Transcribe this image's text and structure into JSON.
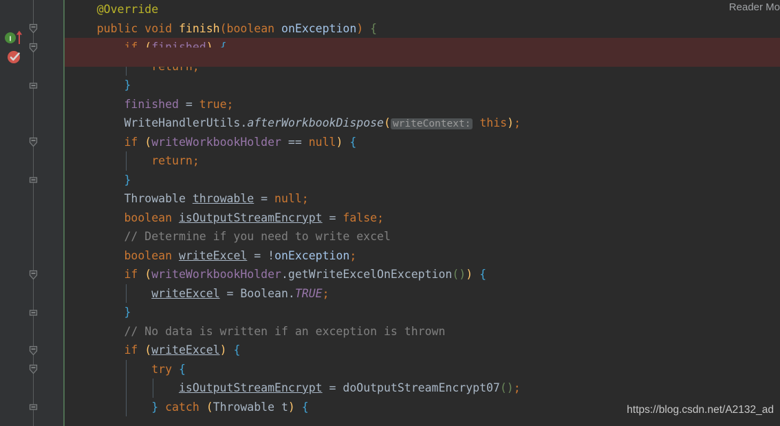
{
  "app": {
    "reader_mode_label": "Reader Mo",
    "watermark": "https://blog.csdn.net/A2132_ad"
  },
  "gutter": {
    "markers": [
      {
        "name": "implementing-method-marker",
        "icon": "implemented-interface-icon",
        "line": 2,
        "tooltip": "Implements method"
      },
      {
        "name": "breakpoint-marker",
        "icon": "breakpoint-verified-icon",
        "line": 3,
        "tooltip": "Line breakpoint verified"
      }
    ],
    "fold_icons": [
      {
        "line": 2,
        "state": "expanded"
      },
      {
        "line": 3,
        "state": "expanded"
      },
      {
        "line": 5,
        "state": "collapsed"
      },
      {
        "line": 8,
        "state": "expanded"
      },
      {
        "line": 10,
        "state": "collapsed"
      },
      {
        "line": 15,
        "state": "expanded"
      },
      {
        "line": 17,
        "state": "collapsed"
      },
      {
        "line": 19,
        "state": "expanded"
      },
      {
        "line": 20,
        "state": "expanded"
      },
      {
        "line": 22,
        "state": "collapsed"
      }
    ],
    "vcs_stripe_color": "#4f6f52"
  },
  "theme": {
    "background": "#2b2b2b",
    "gutter_background": "#313335",
    "default_text": "#a9b7c6",
    "keyword": "#cc7832",
    "annotation": "#bbb529",
    "method_declaration": "#ffc66d",
    "field": "#9876aa",
    "parameter": "#a3c4e8",
    "comment": "#808080",
    "brace": "#42a3d4",
    "breakpoint_line_background": "#4b2b2b",
    "hint_chip_background": "#4e5254",
    "hint_chip_text": "#9b9b9b"
  },
  "code": {
    "language": "Java",
    "lines": [
      {
        "n": 1,
        "indent": 1,
        "highlight": false,
        "guides": [],
        "tokens": [
          {
            "t": "@Override",
            "c": "anno"
          }
        ]
      },
      {
        "n": 2,
        "indent": 1,
        "highlight": false,
        "guides": [],
        "tokens": [
          {
            "t": "public",
            "c": "kw"
          },
          {
            "t": " ",
            "c": "op"
          },
          {
            "t": "void",
            "c": "kw"
          },
          {
            "t": " ",
            "c": "op"
          },
          {
            "t": "finish",
            "c": "mdecl"
          },
          {
            "t": "(",
            "c": "br1"
          },
          {
            "t": "boolean",
            "c": "kw"
          },
          {
            "t": " ",
            "c": "op"
          },
          {
            "t": "onException",
            "c": "param"
          },
          {
            "t": ")",
            "c": "br1"
          },
          {
            "t": " ",
            "c": "op"
          },
          {
            "t": "{",
            "c": "br3"
          }
        ]
      },
      {
        "n": 3,
        "indent": 2,
        "highlight": true,
        "guides": [],
        "tokens": [
          {
            "t": "if",
            "c": "kw"
          },
          {
            "t": " ",
            "c": "op"
          },
          {
            "t": "(",
            "c": "br2"
          },
          {
            "t": "finished",
            "c": "field"
          },
          {
            "t": ")",
            "c": "br2"
          },
          {
            "t": " ",
            "c": "op"
          },
          {
            "t": "{",
            "c": "brace"
          }
        ]
      },
      {
        "n": 4,
        "indent": 3,
        "highlight": false,
        "guides": [
          2
        ],
        "tokens": [
          {
            "t": "return",
            "c": "kw"
          },
          {
            "t": ";",
            "c": "sm"
          }
        ]
      },
      {
        "n": 5,
        "indent": 2,
        "highlight": false,
        "guides": [],
        "tokens": [
          {
            "t": "}",
            "c": "brace"
          }
        ]
      },
      {
        "n": 6,
        "indent": 2,
        "highlight": false,
        "guides": [],
        "tokens": [
          {
            "t": "finished",
            "c": "field"
          },
          {
            "t": " = ",
            "c": "op"
          },
          {
            "t": "true",
            "c": "kw"
          },
          {
            "t": ";",
            "c": "sm"
          }
        ]
      },
      {
        "n": 7,
        "indent": 2,
        "highlight": false,
        "guides": [],
        "tokens": [
          {
            "t": "WriteHandlerUtils",
            "c": "cls"
          },
          {
            "t": ".",
            "c": "op"
          },
          {
            "t": "afterWorkbookDispose",
            "c": "ital"
          },
          {
            "t": "(",
            "c": "br2"
          },
          {
            "t": "HINT:writeContext:",
            "c": "hint"
          },
          {
            "t": " ",
            "c": "op"
          },
          {
            "t": "this",
            "c": "kw"
          },
          {
            "t": ")",
            "c": "br2"
          },
          {
            "t": ";",
            "c": "sm"
          }
        ]
      },
      {
        "n": 8,
        "indent": 2,
        "highlight": false,
        "guides": [],
        "tokens": [
          {
            "t": "if",
            "c": "kw"
          },
          {
            "t": " ",
            "c": "op"
          },
          {
            "t": "(",
            "c": "br2"
          },
          {
            "t": "writeWorkbookHolder",
            "c": "field"
          },
          {
            "t": " == ",
            "c": "op"
          },
          {
            "t": "null",
            "c": "kw"
          },
          {
            "t": ")",
            "c": "br2"
          },
          {
            "t": " ",
            "c": "op"
          },
          {
            "t": "{",
            "c": "brace"
          }
        ]
      },
      {
        "n": 9,
        "indent": 3,
        "highlight": false,
        "guides": [
          2
        ],
        "tokens": [
          {
            "t": "return",
            "c": "kw"
          },
          {
            "t": ";",
            "c": "sm"
          }
        ]
      },
      {
        "n": 10,
        "indent": 2,
        "highlight": false,
        "guides": [],
        "tokens": [
          {
            "t": "}",
            "c": "brace"
          }
        ]
      },
      {
        "n": 11,
        "indent": 2,
        "highlight": false,
        "guides": [],
        "tokens": [
          {
            "t": "Throwable",
            "c": "cls"
          },
          {
            "t": " ",
            "c": "op"
          },
          {
            "t": "throwable",
            "c": "lvar"
          },
          {
            "t": " = ",
            "c": "op"
          },
          {
            "t": "null",
            "c": "kw"
          },
          {
            "t": ";",
            "c": "sm"
          }
        ]
      },
      {
        "n": 12,
        "indent": 2,
        "highlight": false,
        "guides": [],
        "tokens": [
          {
            "t": "boolean",
            "c": "kw"
          },
          {
            "t": " ",
            "c": "op"
          },
          {
            "t": "isOutputStreamEncrypt",
            "c": "lvar"
          },
          {
            "t": " = ",
            "c": "op"
          },
          {
            "t": "false",
            "c": "kw"
          },
          {
            "t": ";",
            "c": "sm"
          }
        ]
      },
      {
        "n": 13,
        "indent": 2,
        "highlight": false,
        "guides": [],
        "tokens": [
          {
            "t": "// Determine if you need to write excel",
            "c": "cmt"
          }
        ]
      },
      {
        "n": 14,
        "indent": 2,
        "highlight": false,
        "guides": [],
        "tokens": [
          {
            "t": "boolean",
            "c": "kw"
          },
          {
            "t": " ",
            "c": "op"
          },
          {
            "t": "writeExcel",
            "c": "lvar"
          },
          {
            "t": " = !",
            "c": "op"
          },
          {
            "t": "onException",
            "c": "param"
          },
          {
            "t": ";",
            "c": "sm"
          }
        ]
      },
      {
        "n": 15,
        "indent": 2,
        "highlight": false,
        "guides": [],
        "tokens": [
          {
            "t": "if",
            "c": "kw"
          },
          {
            "t": " ",
            "c": "op"
          },
          {
            "t": "(",
            "c": "br2"
          },
          {
            "t": "writeWorkbookHolder",
            "c": "field"
          },
          {
            "t": ".",
            "c": "op"
          },
          {
            "t": "getWriteExcelOnException",
            "c": "mcall"
          },
          {
            "t": "()",
            "c": "br3"
          },
          {
            "t": ")",
            "c": "br2"
          },
          {
            "t": " ",
            "c": "op"
          },
          {
            "t": "{",
            "c": "brace"
          }
        ]
      },
      {
        "n": 16,
        "indent": 3,
        "highlight": false,
        "guides": [
          2
        ],
        "tokens": [
          {
            "t": "writeExcel",
            "c": "lvar"
          },
          {
            "t": " = ",
            "c": "op"
          },
          {
            "t": "Boolean",
            "c": "cls"
          },
          {
            "t": ".",
            "c": "op"
          },
          {
            "t": "TRUE",
            "c": "sfield"
          },
          {
            "t": ";",
            "c": "sm"
          }
        ]
      },
      {
        "n": 17,
        "indent": 2,
        "highlight": false,
        "guides": [],
        "tokens": [
          {
            "t": "}",
            "c": "brace"
          }
        ]
      },
      {
        "n": 18,
        "indent": 2,
        "highlight": false,
        "guides": [],
        "tokens": [
          {
            "t": "// No data is written if an exception is thrown",
            "c": "cmt"
          }
        ]
      },
      {
        "n": 19,
        "indent": 2,
        "highlight": false,
        "guides": [],
        "tokens": [
          {
            "t": "if",
            "c": "kw"
          },
          {
            "t": " ",
            "c": "op"
          },
          {
            "t": "(",
            "c": "br2"
          },
          {
            "t": "writeExcel",
            "c": "lvar"
          },
          {
            "t": ")",
            "c": "br2"
          },
          {
            "t": " ",
            "c": "op"
          },
          {
            "t": "{",
            "c": "brace"
          }
        ]
      },
      {
        "n": 20,
        "indent": 3,
        "highlight": false,
        "guides": [
          2
        ],
        "tokens": [
          {
            "t": "try",
            "c": "kw"
          },
          {
            "t": " ",
            "c": "op"
          },
          {
            "t": "{",
            "c": "brace"
          }
        ]
      },
      {
        "n": 21,
        "indent": 4,
        "highlight": false,
        "guides": [
          2,
          3
        ],
        "tokens": [
          {
            "t": "isOutputStreamEncrypt",
            "c": "lvar"
          },
          {
            "t": " = ",
            "c": "op"
          },
          {
            "t": "doOutputStreamEncrypt07",
            "c": "mcall"
          },
          {
            "t": "()",
            "c": "br3"
          },
          {
            "t": ";",
            "c": "sm"
          }
        ]
      },
      {
        "n": 22,
        "indent": 3,
        "highlight": false,
        "guides": [
          2
        ],
        "tokens": [
          {
            "t": "}",
            "c": "brace"
          },
          {
            "t": " ",
            "c": "op"
          },
          {
            "t": "catch",
            "c": "kw"
          },
          {
            "t": " ",
            "c": "op"
          },
          {
            "t": "(",
            "c": "br2"
          },
          {
            "t": "Throwable",
            "c": "cls"
          },
          {
            "t": " ",
            "c": "op"
          },
          {
            "t": "t",
            "c": "op"
          },
          {
            "t": ")",
            "c": "br2"
          },
          {
            "t": " ",
            "c": "op"
          },
          {
            "t": "{",
            "c": "brace"
          }
        ]
      }
    ]
  }
}
